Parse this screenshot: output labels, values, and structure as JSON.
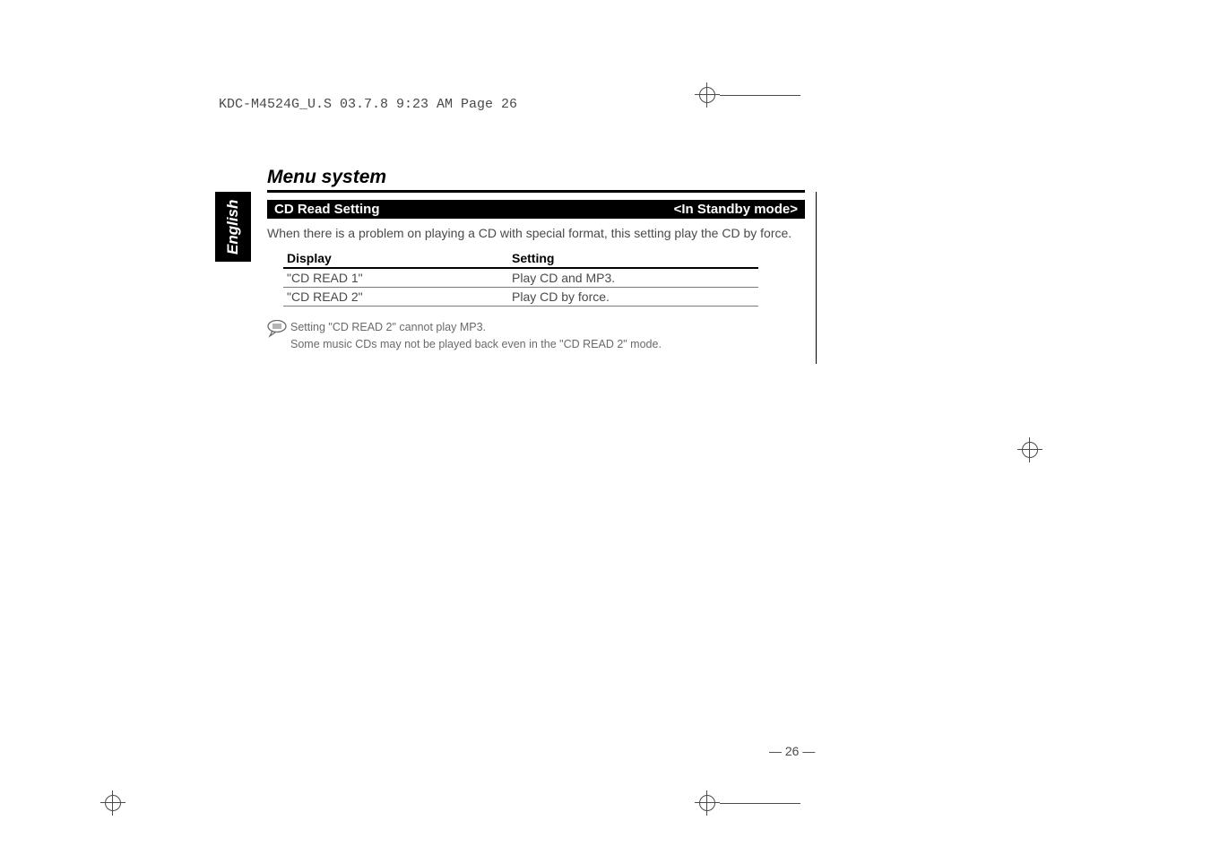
{
  "header_line": "KDC-M4524G_U.S  03.7.8  9:23 AM  Page 26",
  "side_tab": "English",
  "section_title": "Menu system",
  "heading_left": "CD Read Setting",
  "heading_right": "<In Standby mode>",
  "intro": "When there is a problem on playing a CD with special format, this setting play the CD by force.",
  "table": {
    "head_display": "Display",
    "head_setting": "Setting",
    "rows": [
      {
        "display": "\"CD READ 1\"",
        "setting": "Play CD and MP3."
      },
      {
        "display": "\"CD READ 2\"",
        "setting": "Play CD by force."
      }
    ]
  },
  "note_line1": "Setting \"CD READ 2\" cannot play MP3.",
  "note_line2": "Some music CDs may not be played back even in the \"CD READ 2\" mode.",
  "page_num": "— 26 —"
}
